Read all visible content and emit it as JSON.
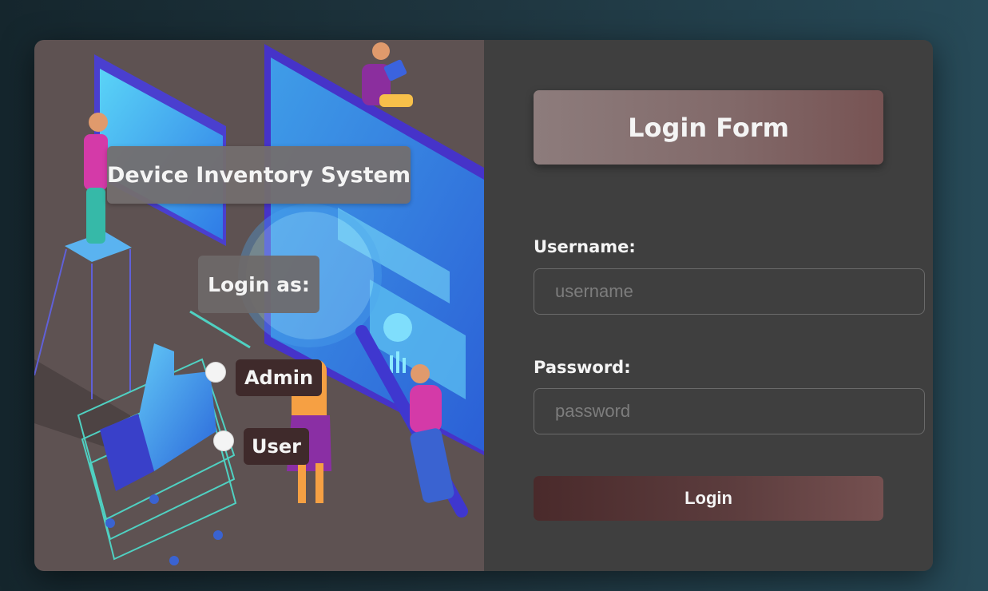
{
  "illustration": {
    "app_title": "Device Inventory System",
    "login_as_label": "Login as:",
    "roles": [
      {
        "label": "Admin"
      },
      {
        "label": "User"
      }
    ]
  },
  "form": {
    "title": "Login Form",
    "username_label": "Username:",
    "username_placeholder": "username",
    "username_value": "",
    "password_label": "Password:",
    "password_placeholder": "password",
    "password_value": "",
    "submit_label": "Login"
  },
  "colors": {
    "page_bg": "#1f3640",
    "left_panel": "#5e5252",
    "right_panel": "#3f3f3f",
    "accent": "#755050",
    "role_label_bg": "#3f2a2b"
  }
}
